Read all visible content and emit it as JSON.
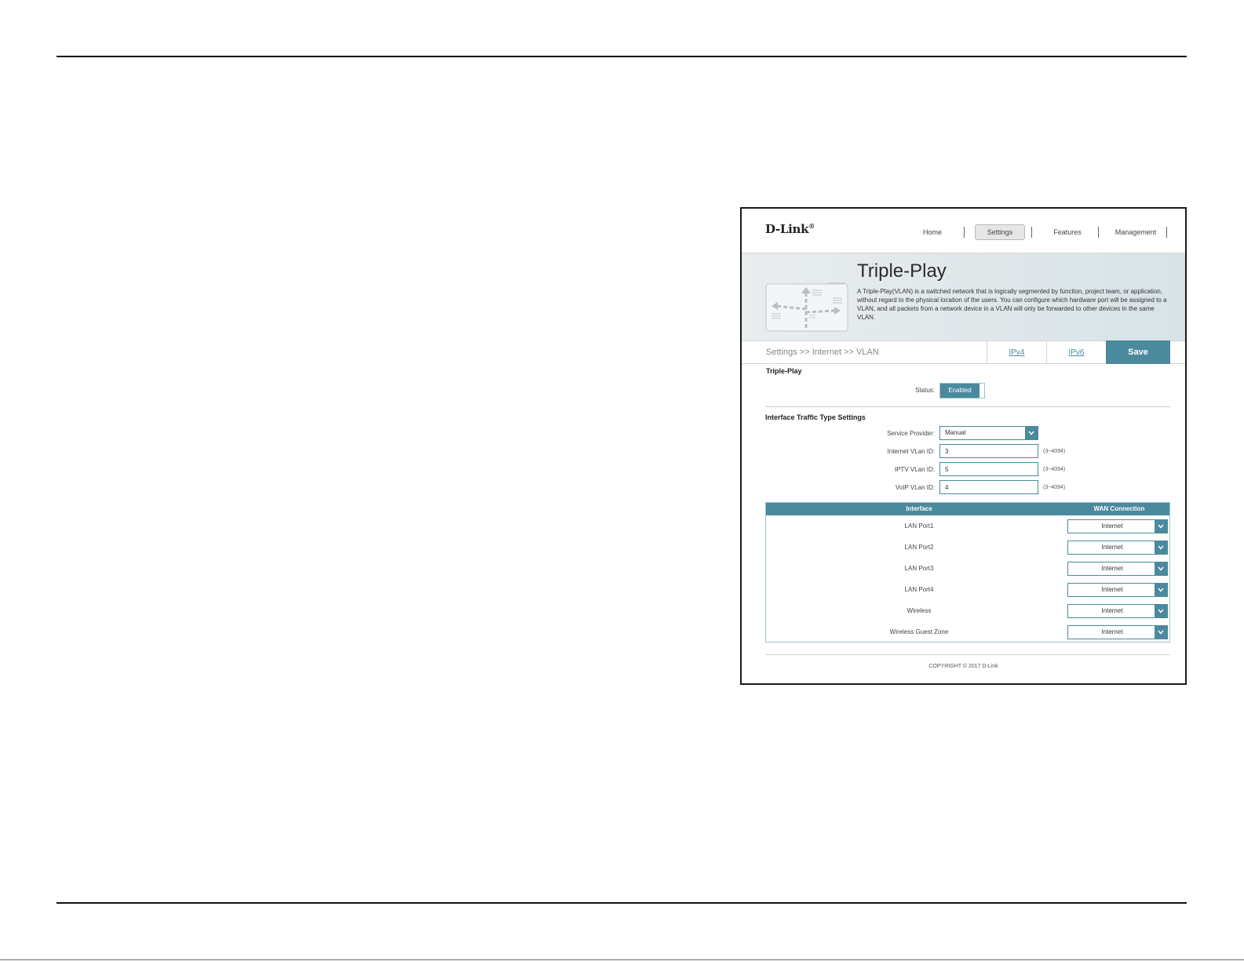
{
  "nav": {
    "logo": "D-Link",
    "logo_mark": "®",
    "items": [
      {
        "label": "Home"
      },
      {
        "label": "Settings"
      },
      {
        "label": "Features"
      },
      {
        "label": "Management"
      }
    ]
  },
  "banner": {
    "title": "Triple-Play",
    "description": "A Triple-Play(VLAN) is a switched network that is logically segmented by function, project team, or application, without regard to the physical location of the users. You can configure which hardware port will be assigned to a VLAN, and all packets from a network device in a VLAN will only be forwarded to other devices in the same VLAN."
  },
  "breadcrumb": "Settings >> Internet >> VLAN",
  "tabs": {
    "ipv4": "IPv4",
    "ipv6": "IPv6"
  },
  "save_label": "Save",
  "triple_play": {
    "section_title": "Triple-Play",
    "status_label": "Status:",
    "status_value": "Enabled"
  },
  "traffic": {
    "section_title": "Interface Traffic Type Settings",
    "service_provider_label": "Service Provider:",
    "service_provider_value": "Manual",
    "fields": [
      {
        "label": "Internet VLan ID:",
        "value": "3",
        "hint": "(3~4094)"
      },
      {
        "label": "IPTV VLan ID:",
        "value": "5",
        "hint": "(3~4094)"
      },
      {
        "label": "VoIP VLan ID:",
        "value": "4",
        "hint": "(3~4094)"
      }
    ]
  },
  "table": {
    "headers": {
      "interface": "Interface",
      "wan": "WAN Connection"
    },
    "rows": [
      {
        "interface": "LAN Port1",
        "wan": "Internet"
      },
      {
        "interface": "LAN Port2",
        "wan": "Internet"
      },
      {
        "interface": "LAN Port3",
        "wan": "Internet"
      },
      {
        "interface": "LAN Port4",
        "wan": "Internet"
      },
      {
        "interface": "Wireless",
        "wan": "Internet"
      },
      {
        "interface": "Wireless Guest Zone",
        "wan": "Internet"
      }
    ]
  },
  "copyright": "COPYRIGHT © 2017 D-Link",
  "colors": {
    "accent": "#4b8a9c",
    "banner": "#dfe7ea"
  }
}
